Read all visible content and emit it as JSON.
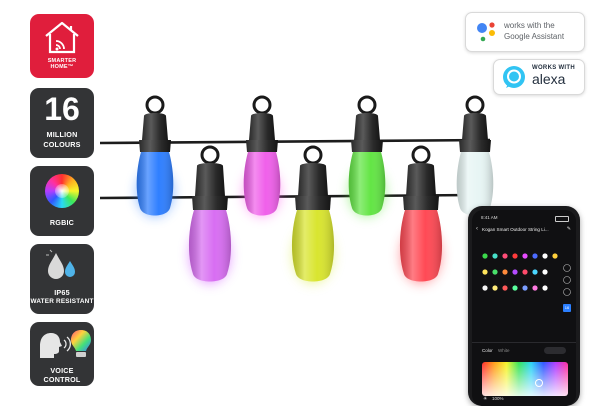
{
  "badges": {
    "smart_home": {
      "label_line1": "SMARTER",
      "label_line2": "HOME™",
      "icon": "house-wifi-icon"
    },
    "colours": {
      "number": "16",
      "line1": "MILLION",
      "line2": "COLOURS"
    },
    "rgbic": {
      "label": "RGBIC",
      "icon": "color-wheel-icon"
    },
    "water": {
      "line1": "IP65",
      "line2": "WATER RESISTANT",
      "icon": "droplets-icon"
    },
    "voice": {
      "line1": "VOICE",
      "line2": "CONTROL",
      "icon": "voice-bulb-icon"
    }
  },
  "google": {
    "line1": "works with the",
    "line2": "Google Assistant",
    "icon": "google-assistant-icon"
  },
  "alexa": {
    "line1": "WORKS WITH",
    "line2": "alexa",
    "icon": "alexa-icon"
  },
  "phone": {
    "time": "8:41 AM",
    "title": "Kogan Smart Outdoor String Li...",
    "tab_color": "Color",
    "tab_white": "White",
    "brightness": "100%",
    "badge_number": "16"
  },
  "colors": {
    "smart_red": "#e01e3c",
    "badge_dark": "#333436",
    "bulbs": [
      "#2f7fff",
      "#ff54ec",
      "#cc44ff",
      "#5ce63a",
      "#d6ea3a",
      "#eaf6f6",
      "#ff3d46"
    ]
  }
}
